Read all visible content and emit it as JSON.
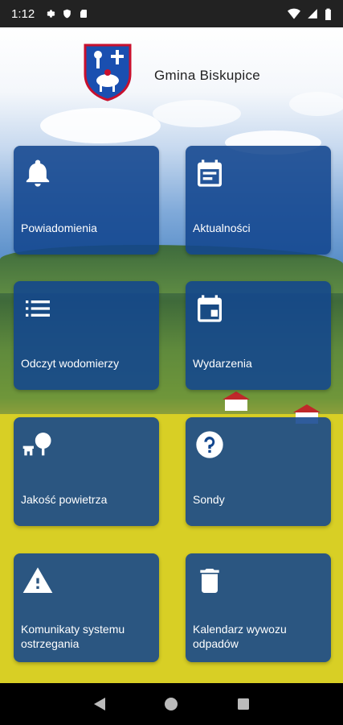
{
  "status_bar": {
    "time": "1:12"
  },
  "header": {
    "title": "Gmina Biskupice"
  },
  "tiles": [
    {
      "label": "Powiadomienia",
      "icon": "bell-icon"
    },
    {
      "label": "Aktualności",
      "icon": "news-icon"
    },
    {
      "label": "Odczyt wodomierzy",
      "icon": "list-icon"
    },
    {
      "label": "Wydarzenia",
      "icon": "calendar-icon"
    },
    {
      "label": "Jakość powietrza",
      "icon": "tree-bench-icon"
    },
    {
      "label": "Sondy",
      "icon": "question-icon"
    },
    {
      "label": "Komunikaty systemu ostrzegania",
      "icon": "warning-icon"
    },
    {
      "label": "Kalendarz wywozu odpadów",
      "icon": "trash-icon"
    }
  ],
  "colors": {
    "tile_bg": "#12468E",
    "status_bar": "#222222",
    "crest_blue": "#1a4fb0",
    "crest_red": "#c8102e"
  }
}
